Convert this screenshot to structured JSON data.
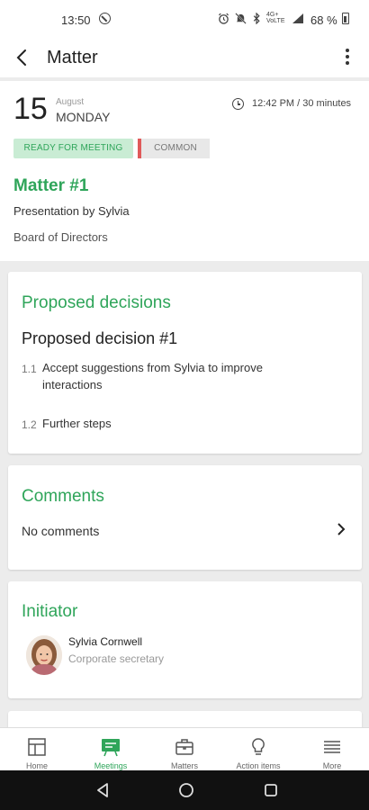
{
  "status_bar": {
    "time": "13:50",
    "network": "4G+ VoLTE",
    "battery": "68 %"
  },
  "app_bar": {
    "title": "Matter"
  },
  "meeting": {
    "day": "15",
    "month": "August",
    "weekday": "MONDAY",
    "time_range": "12:42 PM / 30 minutes",
    "tags": [
      "READY FOR MEETING",
      "COMMON"
    ],
    "tag_colors": {
      "ready_bg": "#c9ecd4",
      "ready_text": "#2fa55a",
      "common_accent": "#e05a5a"
    }
  },
  "matter": {
    "title": "Matter #1",
    "presenter": "Presentation by Sylvia",
    "body": "Board of Directors"
  },
  "decisions": {
    "heading": "Proposed decisions",
    "decision_title": "Proposed decision #1",
    "items": [
      {
        "num": "1.1",
        "text": "Accept suggestions from Sylvia to improve interactions"
      },
      {
        "num": "1.2",
        "text": "Further steps"
      }
    ]
  },
  "comments": {
    "heading": "Comments",
    "empty_text": "No comments"
  },
  "initiator": {
    "heading": "Initiator",
    "name": "Sylvia Cornwell",
    "role": "Corporate secretary"
  },
  "bottom_nav": {
    "items": [
      {
        "label": "Home",
        "icon": "home-icon"
      },
      {
        "label": "Meetings",
        "icon": "meetings-icon"
      },
      {
        "label": "Matters",
        "icon": "briefcase-icon"
      },
      {
        "label": "Action items",
        "icon": "lightbulb-icon"
      },
      {
        "label": "More",
        "icon": "menu-icon"
      }
    ],
    "active": "Meetings"
  },
  "colors": {
    "accent": "#2fa55a",
    "background": "#ececec"
  }
}
